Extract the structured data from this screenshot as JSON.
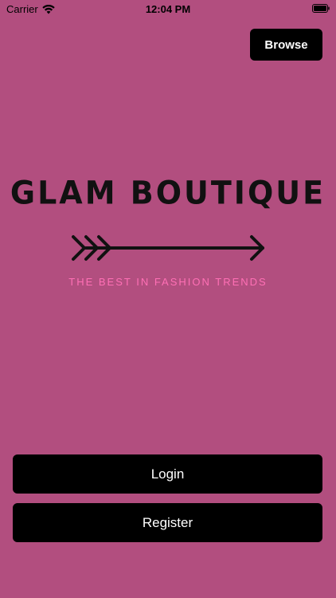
{
  "status_bar": {
    "carrier": "Carrier",
    "time": "12:04 PM"
  },
  "header": {
    "browse_label": "Browse"
  },
  "brand": {
    "title": "GLAM BOUTIQUE",
    "tagline": "THE BEST IN FASHION TRENDS"
  },
  "actions": {
    "login_label": "Login",
    "register_label": "Register"
  },
  "icons": {
    "wifi": "wifi-icon",
    "battery": "battery-icon",
    "arrow": "arrow-icon"
  },
  "colors": {
    "background": "#b24e7f",
    "button": "#000000",
    "tagline": "#ff6fb5"
  }
}
